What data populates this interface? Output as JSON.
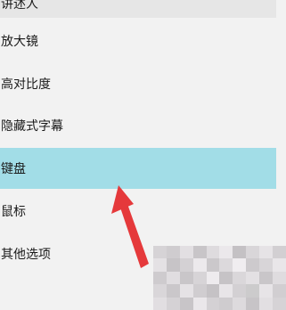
{
  "menu": {
    "items": [
      {
        "label": "讲述人",
        "selected": false
      },
      {
        "label": "放大镜",
        "selected": false
      },
      {
        "label": "高对比度",
        "selected": false
      },
      {
        "label": "隐藏式字幕",
        "selected": false
      },
      {
        "label": "键盘",
        "selected": true
      },
      {
        "label": "鼠标",
        "selected": false
      },
      {
        "label": "其他选项",
        "selected": false
      }
    ]
  },
  "colors": {
    "background": "#f2f2f2",
    "selected_row": "#a2dde7",
    "arrow": "#e5393b"
  }
}
